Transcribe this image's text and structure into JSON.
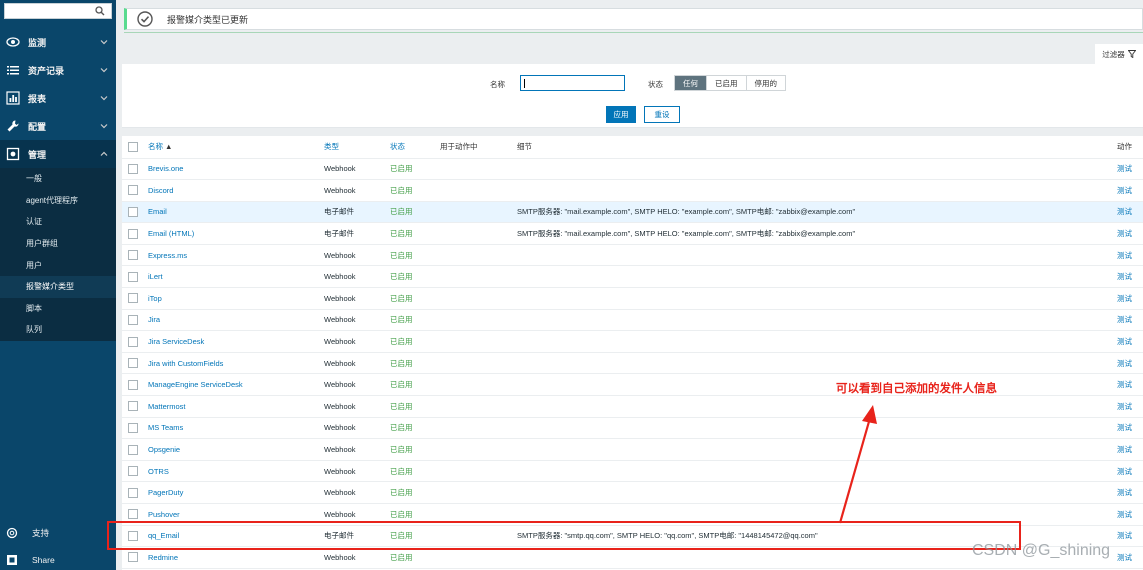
{
  "sidebar": {
    "search_placeholder": "",
    "menu": [
      {
        "label": "监测"
      },
      {
        "label": "资产记录"
      },
      {
        "label": "报表"
      },
      {
        "label": "配置"
      },
      {
        "label": "管理"
      }
    ],
    "admin_submenu": [
      {
        "label": "一般"
      },
      {
        "label": "agent代理程序"
      },
      {
        "label": "认证"
      },
      {
        "label": "用户群组"
      },
      {
        "label": "用户"
      },
      {
        "label": "报警媒介类型"
      },
      {
        "label": "脚本"
      },
      {
        "label": "队列"
      }
    ],
    "support_label": "支持",
    "share_label": "Share"
  },
  "message": {
    "text": "报警媒介类型已更新"
  },
  "filter": {
    "tab_label": "过滤器",
    "name_label": "名称",
    "name_value": "",
    "status_label": "状态",
    "status_options": [
      "任何",
      "已启用",
      "停用的"
    ],
    "apply_label": "应用",
    "reset_label": "重设"
  },
  "table": {
    "headers": {
      "name": "名称",
      "sort_indicator": "▲",
      "type": "类型",
      "status": "状态",
      "used_in_actions": "用于动作中",
      "details": "细节",
      "action": "动作"
    },
    "rows": [
      {
        "name": "Brevis.one",
        "type": "Webhook",
        "status": "已启用",
        "details": "",
        "action": "测试"
      },
      {
        "name": "Discord",
        "type": "Webhook",
        "status": "已启用",
        "details": "",
        "action": "测试"
      },
      {
        "name": "Email",
        "type": "电子邮件",
        "status": "已启用",
        "details": "SMTP服务器: \"mail.example.com\", SMTP HELO: \"example.com\", SMTP电邮: \"zabbix@example.com\"",
        "action": "测试"
      },
      {
        "name": "Email (HTML)",
        "type": "电子邮件",
        "status": "已启用",
        "details": "SMTP服务器: \"mail.example.com\", SMTP HELO: \"example.com\", SMTP电邮: \"zabbix@example.com\"",
        "action": "测试"
      },
      {
        "name": "Express.ms",
        "type": "Webhook",
        "status": "已启用",
        "details": "",
        "action": "测试"
      },
      {
        "name": "iLert",
        "type": "Webhook",
        "status": "已启用",
        "details": "",
        "action": "测试"
      },
      {
        "name": "iTop",
        "type": "Webhook",
        "status": "已启用",
        "details": "",
        "action": "测试"
      },
      {
        "name": "Jira",
        "type": "Webhook",
        "status": "已启用",
        "details": "",
        "action": "测试"
      },
      {
        "name": "Jira ServiceDesk",
        "type": "Webhook",
        "status": "已启用",
        "details": "",
        "action": "测试"
      },
      {
        "name": "Jira with CustomFields",
        "type": "Webhook",
        "status": "已启用",
        "details": "",
        "action": "测试"
      },
      {
        "name": "ManageEngine ServiceDesk",
        "type": "Webhook",
        "status": "已启用",
        "details": "",
        "action": "测试"
      },
      {
        "name": "Mattermost",
        "type": "Webhook",
        "status": "已启用",
        "details": "",
        "action": "测试"
      },
      {
        "name": "MS Teams",
        "type": "Webhook",
        "status": "已启用",
        "details": "",
        "action": "测试"
      },
      {
        "name": "Opsgenie",
        "type": "Webhook",
        "status": "已启用",
        "details": "",
        "action": "测试"
      },
      {
        "name": "OTRS",
        "type": "Webhook",
        "status": "已启用",
        "details": "",
        "action": "测试"
      },
      {
        "name": "PagerDuty",
        "type": "Webhook",
        "status": "已启用",
        "details": "",
        "action": "测试"
      },
      {
        "name": "Pushover",
        "type": "Webhook",
        "status": "已启用",
        "details": "",
        "action": "测试"
      },
      {
        "name": "qq_Email",
        "type": "电子邮件",
        "status": "已启用",
        "details": "SMTP服务器: \"smtp.qq.com\", SMTP HELO: \"qq.com\", SMTP电邮: \"1448145472@qq.com\"",
        "action": "测试"
      },
      {
        "name": "Redmine",
        "type": "Webhook",
        "status": "已启用",
        "details": "",
        "action": "测试"
      }
    ]
  },
  "annotation": {
    "text": "可以看到自己添加的发件人信息",
    "color": "#e8231b"
  },
  "watermark": "CSDN @G_shining",
  "colors": {
    "sidebar_bg": "#0a466a",
    "link": "#0275b8",
    "status_enabled": "#429e47",
    "success_border": "#59db8f"
  }
}
